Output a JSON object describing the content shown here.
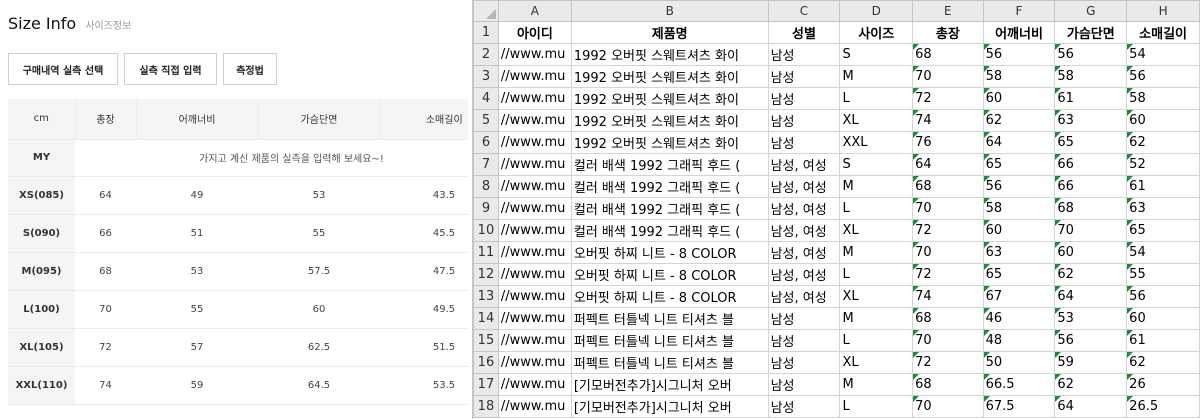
{
  "size_info": {
    "title": "Size Info",
    "subtitle": "사이즈정보",
    "buttons": [
      "구매내역 실측 선택",
      "실측 직접 입력",
      "측정법"
    ],
    "columns": [
      "cm",
      "총장",
      "어깨너비",
      "가슴단면",
      "소매길이"
    ],
    "my_label": "MY",
    "my_message": "가지고 계신 제품의 실측을 입력해 보세요~!",
    "rows": [
      {
        "size": "XS(085)",
        "values": [
          "64",
          "49",
          "53",
          "43.5"
        ]
      },
      {
        "size": "S(090)",
        "values": [
          "66",
          "51",
          "55",
          "45.5"
        ]
      },
      {
        "size": "M(095)",
        "values": [
          "68",
          "53",
          "57.5",
          "47.5"
        ]
      },
      {
        "size": "L(100)",
        "values": [
          "70",
          "55",
          "60",
          "49.5"
        ]
      },
      {
        "size": "XL(105)",
        "values": [
          "72",
          "57",
          "62.5",
          "51.5"
        ]
      },
      {
        "size": "XXL(110)",
        "values": [
          "74",
          "59",
          "64.5",
          "53.5"
        ]
      }
    ]
  },
  "sheet": {
    "column_letters": [
      "A",
      "B",
      "C",
      "D",
      "E",
      "F",
      "G",
      "H"
    ],
    "header": [
      "아이디",
      "제품명",
      "성별",
      "사이즈",
      "총장",
      "어깨너비",
      "가슴단면",
      "소매길이"
    ],
    "rows": [
      [
        "//www.mu",
        "1992 오버핏 스웨트셔츠 화이",
        "남성",
        "S",
        "68",
        "56",
        "56",
        "54"
      ],
      [
        "//www.mu",
        "1992 오버핏 스웨트셔츠 화이",
        "남성",
        "M",
        "70",
        "58",
        "58",
        "56"
      ],
      [
        "//www.mu",
        "1992 오버핏 스웨트셔츠 화이",
        "남성",
        "L",
        "72",
        "60",
        "61",
        "58"
      ],
      [
        "//www.mu",
        "1992 오버핏 스웨트셔츠 화이",
        "남성",
        "XL",
        "74",
        "62",
        "63",
        "60"
      ],
      [
        "//www.mu",
        "1992 오버핏 스웨트셔츠 화이",
        "남성",
        "XXL",
        "76",
        "64",
        "65",
        "62"
      ],
      [
        "//www.mu",
        "컬러 배색 1992 그래픽 후드 (",
        "남성, 여성",
        "S",
        "64",
        "65",
        "66",
        "52"
      ],
      [
        "//www.mu",
        "컬러 배색 1992 그래픽 후드 (",
        "남성, 여성",
        "M",
        "68",
        "56",
        "66",
        "61"
      ],
      [
        "//www.mu",
        "컬러 배색 1992 그래픽 후드 (",
        "남성, 여성",
        "L",
        "70",
        "58",
        "68",
        "63"
      ],
      [
        "//www.mu",
        "컬러 배색 1992 그래픽 후드 (",
        "남성, 여성",
        "XL",
        "72",
        "60",
        "70",
        "65"
      ],
      [
        "//www.mu",
        "오버핏 하찌 니트 - 8 COLOR",
        "남성, 여성",
        "M",
        "70",
        "63",
        "60",
        "54"
      ],
      [
        "//www.mu",
        "오버핏 하찌 니트 - 8 COLOR",
        "남성, 여성",
        "L",
        "72",
        "65",
        "62",
        "55"
      ],
      [
        "//www.mu",
        "오버핏 하찌 니트 - 8 COLOR",
        "남성, 여성",
        "XL",
        "74",
        "67",
        "64",
        "56"
      ],
      [
        "//www.mu",
        "퍼펙트 터틀넥 니트 티셔츠 블",
        "남성",
        "M",
        "68",
        "46",
        "53",
        "60"
      ],
      [
        "//www.mu",
        "퍼펙트 터틀넥 니트 티셔츠 블",
        "남성",
        "L",
        "70",
        "48",
        "56",
        "61"
      ],
      [
        "//www.mu",
        "퍼펙트 터틀넥 니트 티셔츠 블",
        "남성",
        "XL",
        "72",
        "50",
        "59",
        "62"
      ],
      [
        "//www.mu",
        "[기모버전추가]시그니처 오버",
        "남성",
        "M",
        "68",
        "66.5",
        "62",
        "26"
      ],
      [
        "//www.mu",
        "[기모버전추가]시그니처 오버",
        "남성",
        "L",
        "70",
        "67.5",
        "64",
        "26.5"
      ]
    ]
  }
}
